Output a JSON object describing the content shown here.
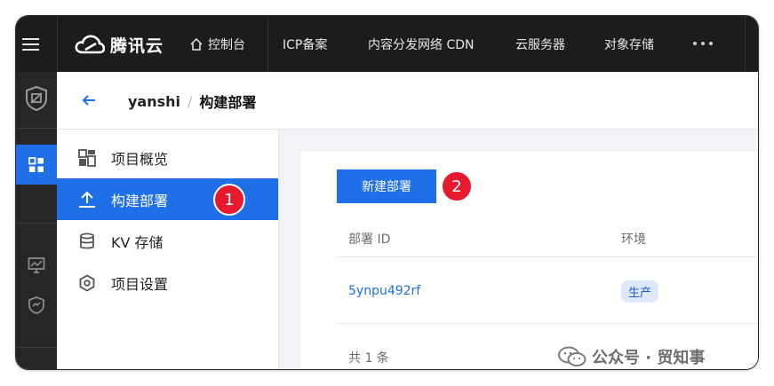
{
  "topbar": {
    "brand": "腾讯云",
    "nav": [
      {
        "label": "控制台",
        "icon": "home-icon"
      },
      {
        "label": "ICP备案"
      },
      {
        "label": "内容分发网络 CDN"
      },
      {
        "label": "云服务器"
      },
      {
        "label": "对象存储"
      }
    ],
    "more_icon": "more-dots-icon"
  },
  "rail": {
    "icons": [
      "shield-app-icon",
      "grid-apps-icon",
      "monitor-chart-icon",
      "monitor-shield-icon"
    ]
  },
  "header": {
    "back_icon": "arrow-left-icon",
    "breadcrumb": {
      "project": "yanshi",
      "separator": "/",
      "page": "构建部署"
    }
  },
  "sidenav": {
    "items": [
      {
        "label": "项目概览",
        "icon": "overview-icon"
      },
      {
        "label": "构建部署",
        "icon": "upload-icon",
        "active": true,
        "marker": "1"
      },
      {
        "label": "KV 存储",
        "icon": "database-icon"
      },
      {
        "label": "项目设置",
        "icon": "settings-hex-icon"
      }
    ]
  },
  "main": {
    "new_button": "新建部署",
    "marker2": "2",
    "columns": [
      "部署 ID",
      "环境"
    ],
    "rows": [
      {
        "id": "5ynpu492rf",
        "env": "生产"
      }
    ],
    "total": "共 1 条"
  },
  "watermark": {
    "text": "公众号 · 贸知事"
  },
  "colors": {
    "accent": "#1e6fe8",
    "marker": "#e6192f",
    "topbar": "#1c1c1c",
    "rail": "#262626"
  }
}
